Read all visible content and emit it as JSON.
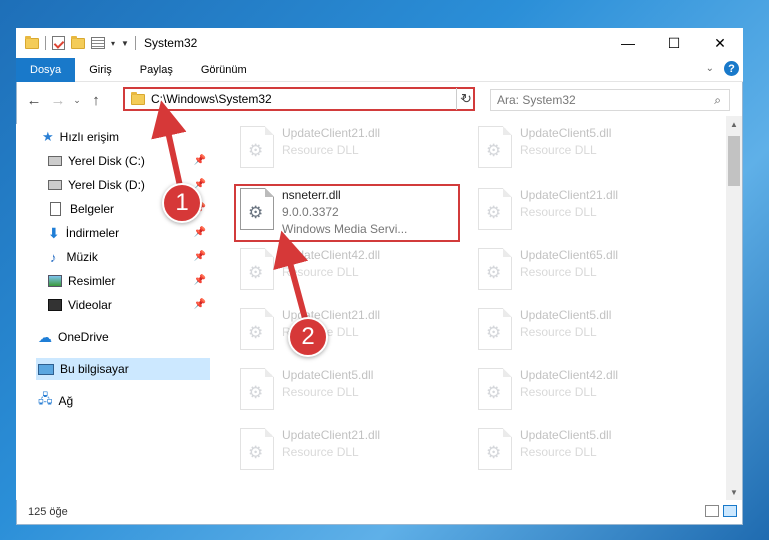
{
  "window": {
    "title": "System32",
    "minimize": "—",
    "maximize": "☐",
    "close": "✕"
  },
  "ribbon": {
    "tabs": [
      "Dosya",
      "Giriş",
      "Paylaş",
      "Görünüm"
    ],
    "active_tab": "Dosya",
    "expand": "⌄",
    "help": "?"
  },
  "nav": {
    "back": "←",
    "forward": "→",
    "recent": "⌄",
    "up": "↑",
    "address": "C:\\Windows\\System32",
    "address_dropdown": "⌄",
    "refresh": "↻",
    "search_placeholder": "Ara: System32",
    "search_icon": "⌕"
  },
  "sidebar": {
    "items": [
      {
        "label": "Hızlı erişim",
        "icon": "star-icon"
      },
      {
        "label": "Yerel Disk (C:)",
        "icon": "disk-icon",
        "pinned": true
      },
      {
        "label": "Yerel Disk (D:)",
        "icon": "disk-icon",
        "pinned": true
      },
      {
        "label": "Belgeler",
        "icon": "document-icon",
        "pinned": true
      },
      {
        "label": "İndirmeler",
        "icon": "download-icon",
        "pinned": true
      },
      {
        "label": "Müzik",
        "icon": "music-icon",
        "pinned": true
      },
      {
        "label": "Resimler",
        "icon": "picture-icon",
        "pinned": true
      },
      {
        "label": "Videolar",
        "icon": "video-icon",
        "pinned": true
      },
      {
        "label": "OneDrive",
        "icon": "cloud-icon"
      },
      {
        "label": "Bu bilgisayar",
        "icon": "computer-icon",
        "selected": true
      },
      {
        "label": "Ağ",
        "icon": "network-icon"
      }
    ],
    "pin_glyph": "📌"
  },
  "files": {
    "left": [
      {
        "name": "UpdateClient21.dll",
        "sub": "Resource DLL"
      },
      {
        "name": "nsneterr.dll",
        "version": "9.0.0.3372",
        "desc": "Windows Media Servi..."
      },
      {
        "name": "UpdateClient42.dll",
        "sub": "Resource DLL"
      },
      {
        "name": "UpdateClient21.dll",
        "sub": "Resource DLL"
      },
      {
        "name": "UpdateClient5.dll",
        "sub": "Resource DLL"
      },
      {
        "name": "UpdateClient21.dll",
        "sub": "Resource DLL"
      }
    ],
    "right": [
      {
        "name": "UpdateClient5.dll",
        "sub": "Resource DLL"
      },
      {
        "name": "UpdateClient21.dll",
        "sub": "Resource DLL"
      },
      {
        "name": "UpdateClient65.dll",
        "sub": "Resource DLL"
      },
      {
        "name": "UpdateClient5.dll",
        "sub": "Resource DLL"
      },
      {
        "name": "UpdateClient42.dll",
        "sub": "Resource DLL"
      },
      {
        "name": "UpdateClient5.dll",
        "sub": "Resource DLL"
      }
    ]
  },
  "status": {
    "count": "125 öğe"
  },
  "callouts": [
    "1",
    "2"
  ],
  "colors": {
    "accent": "#1979ca",
    "callout": "#d63838",
    "highlight": "#d23b3b"
  }
}
